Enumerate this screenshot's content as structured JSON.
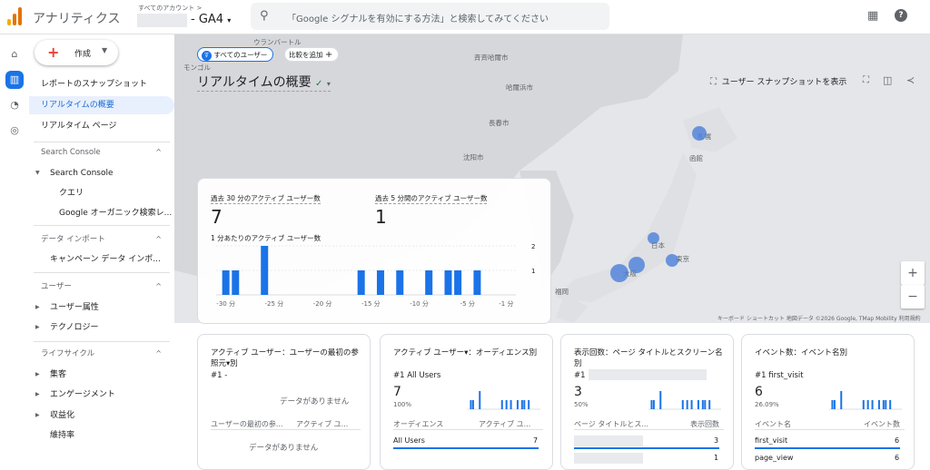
{
  "header": {
    "app_title": "アナリティクス",
    "account_label": "すべてのアカウント >",
    "property_name": "- GA4",
    "search_placeholder": "「Google シグナルを有効にする方法」と検索してみてください",
    "icons": [
      "search-icon",
      "apps-icon",
      "help-icon"
    ]
  },
  "sidebar": {
    "create_label": "作成",
    "items": [
      {
        "label": "レポートのスナップショット"
      },
      {
        "label": "リアルタイムの概要",
        "active": true
      },
      {
        "label": "リアルタイム ページ"
      }
    ],
    "sections": [
      {
        "label": "Search Console"
      },
      {
        "label": "Search Console"
      },
      {
        "label": "クエリ"
      },
      {
        "label": "Google オーガニック検索レ..."
      },
      {
        "label": "データ インポート"
      },
      {
        "label": "キャンペーン データ インポ..."
      },
      {
        "label": "ユーザー"
      },
      {
        "label": "ユーザー属性"
      },
      {
        "label": "テクノロジー"
      },
      {
        "label": "ライフサイクル"
      },
      {
        "label": "集客"
      },
      {
        "label": "エンゲージメント"
      },
      {
        "label": "収益化"
      },
      {
        "label": "維持率"
      }
    ]
  },
  "page": {
    "title": "リアルタイムの概要",
    "chip_all_users": "すべてのユーザー",
    "chip_compare": "比較を追加",
    "snapshot_label": "ユーザー スナップショットを表示"
  },
  "map": {
    "labels": {
      "ulaanbaatar": "ウランバートル",
      "mongolia": "モンゴル",
      "qiqihar": "斉斉哈爾市",
      "harbin": "哈爾浜市",
      "changchun": "長春市",
      "shenyang": "沈阳市",
      "sapporo": "札幌",
      "hakodate": "函館",
      "japan": "日本",
      "tokyo": "東京",
      "osaka": "大阪",
      "fukuoka": "福岡"
    },
    "attribution": "キーボード ショートカット   地図データ ©2026 Google, TMap Mobility   利用規約"
  },
  "realtime_card": {
    "label_30min": "過去 30 分のアクティブ ユーザー数",
    "value_30min": "7",
    "label_5min": "過去 5 分間のアクティブ ユーザー数",
    "value_5min": "1",
    "chart_label": "1 分あたりのアクティブ ユーザー数"
  },
  "chart_data": {
    "type": "bar",
    "title": "1 分あたりのアクティブ ユーザー数",
    "x_ticks": [
      "-30 分",
      "-25 分",
      "-20 分",
      "-15 分",
      "-10 分",
      "-5 分",
      "-1 分"
    ],
    "y_ticks": [
      "1",
      "2"
    ],
    "ylim": [
      0,
      2
    ],
    "x": [
      -30,
      -29,
      -26,
      -16,
      -14,
      -12,
      -9,
      -7,
      -6,
      -4
    ],
    "values": [
      1,
      1,
      2,
      1,
      1,
      1,
      1,
      1,
      1,
      1
    ],
    "color": "#1a73e8"
  },
  "cards": [
    {
      "title": "アクティブ ユーザー：ユーザーの最初の参照元▾別",
      "rank": "#1 -",
      "no_data": "データがありません",
      "col1": "ユーザーの最初の参...",
      "col2": "アクティブ ユ...",
      "no_data_bottom": "データがありません"
    },
    {
      "title": "アクティブ ユーザー▾：オーディエンス別",
      "rank": "#1 All Users",
      "value": "7",
      "pct": "100%",
      "col1": "オーディエンス",
      "col2": "アクティブ ユ...",
      "rows": [
        {
          "name": "All Users",
          "value": "7"
        }
      ]
    },
    {
      "title": "表示回数：ページ タイトルとスクリーン名別",
      "rank": "#1",
      "value": "3",
      "pct": "50%",
      "col1": "ページ タイトルとス...",
      "col2": "表示回数",
      "rows": [
        {
          "name": "",
          "value": "3"
        },
        {
          "name": "",
          "value": "1"
        }
      ]
    },
    {
      "title": "イベント数：イベント名別",
      "rank": "#1 first_visit",
      "value": "6",
      "pct": "26.09%",
      "col1": "イベント名",
      "col2": "イベント数",
      "rows": [
        {
          "name": "first_visit",
          "value": "6"
        },
        {
          "name": "page_view",
          "value": "6"
        }
      ]
    }
  ],
  "colors": {
    "accent": "#1a73e8",
    "map_bg": "#e5e6e9",
    "bubble": "#4a80d9"
  }
}
